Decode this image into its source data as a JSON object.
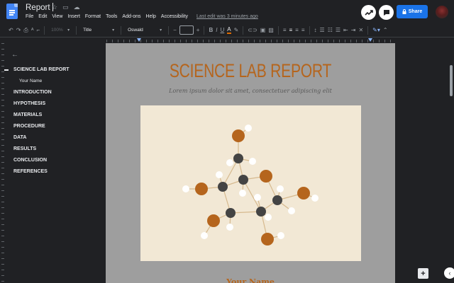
{
  "header": {
    "title": "Report",
    "menu": [
      "File",
      "Edit",
      "View",
      "Insert",
      "Format",
      "Tools",
      "Add-ons",
      "Help",
      "Accessibility"
    ],
    "last_edit": "Last edit was 3 minutes ago",
    "share_label": "Share"
  },
  "toolbar": {
    "zoom": "100%",
    "style": "Title",
    "font": "Oswald",
    "size": ""
  },
  "outline": {
    "items": [
      {
        "label": "SCIENCE LAB REPORT",
        "level": 1,
        "active": true
      },
      {
        "label": "Your Name",
        "level": 2
      },
      {
        "label": "INTRODUCTION",
        "level": 1
      },
      {
        "label": "HYPOTHESIS",
        "level": 1
      },
      {
        "label": "MATERIALS",
        "level": 1
      },
      {
        "label": "PROCEDURE",
        "level": 1
      },
      {
        "label": "DATA",
        "level": 1
      },
      {
        "label": "RESULTS",
        "level": 1
      },
      {
        "label": "CONCLUSION",
        "level": 1
      },
      {
        "label": "REFERENCES",
        "level": 1
      }
    ]
  },
  "document": {
    "title": "SCIENCE LAB REPORT",
    "subtitle": "Lorem ipsum dolor sit amet, consectetuer adipiscing elit",
    "name_heading": "Your Name"
  },
  "colors": {
    "accent": "#b5651d",
    "figure_bg": "#f2e8d5",
    "share_blue": "#1a73e8",
    "canvas_bg": "#9e9e9e",
    "chrome": "#202124"
  }
}
